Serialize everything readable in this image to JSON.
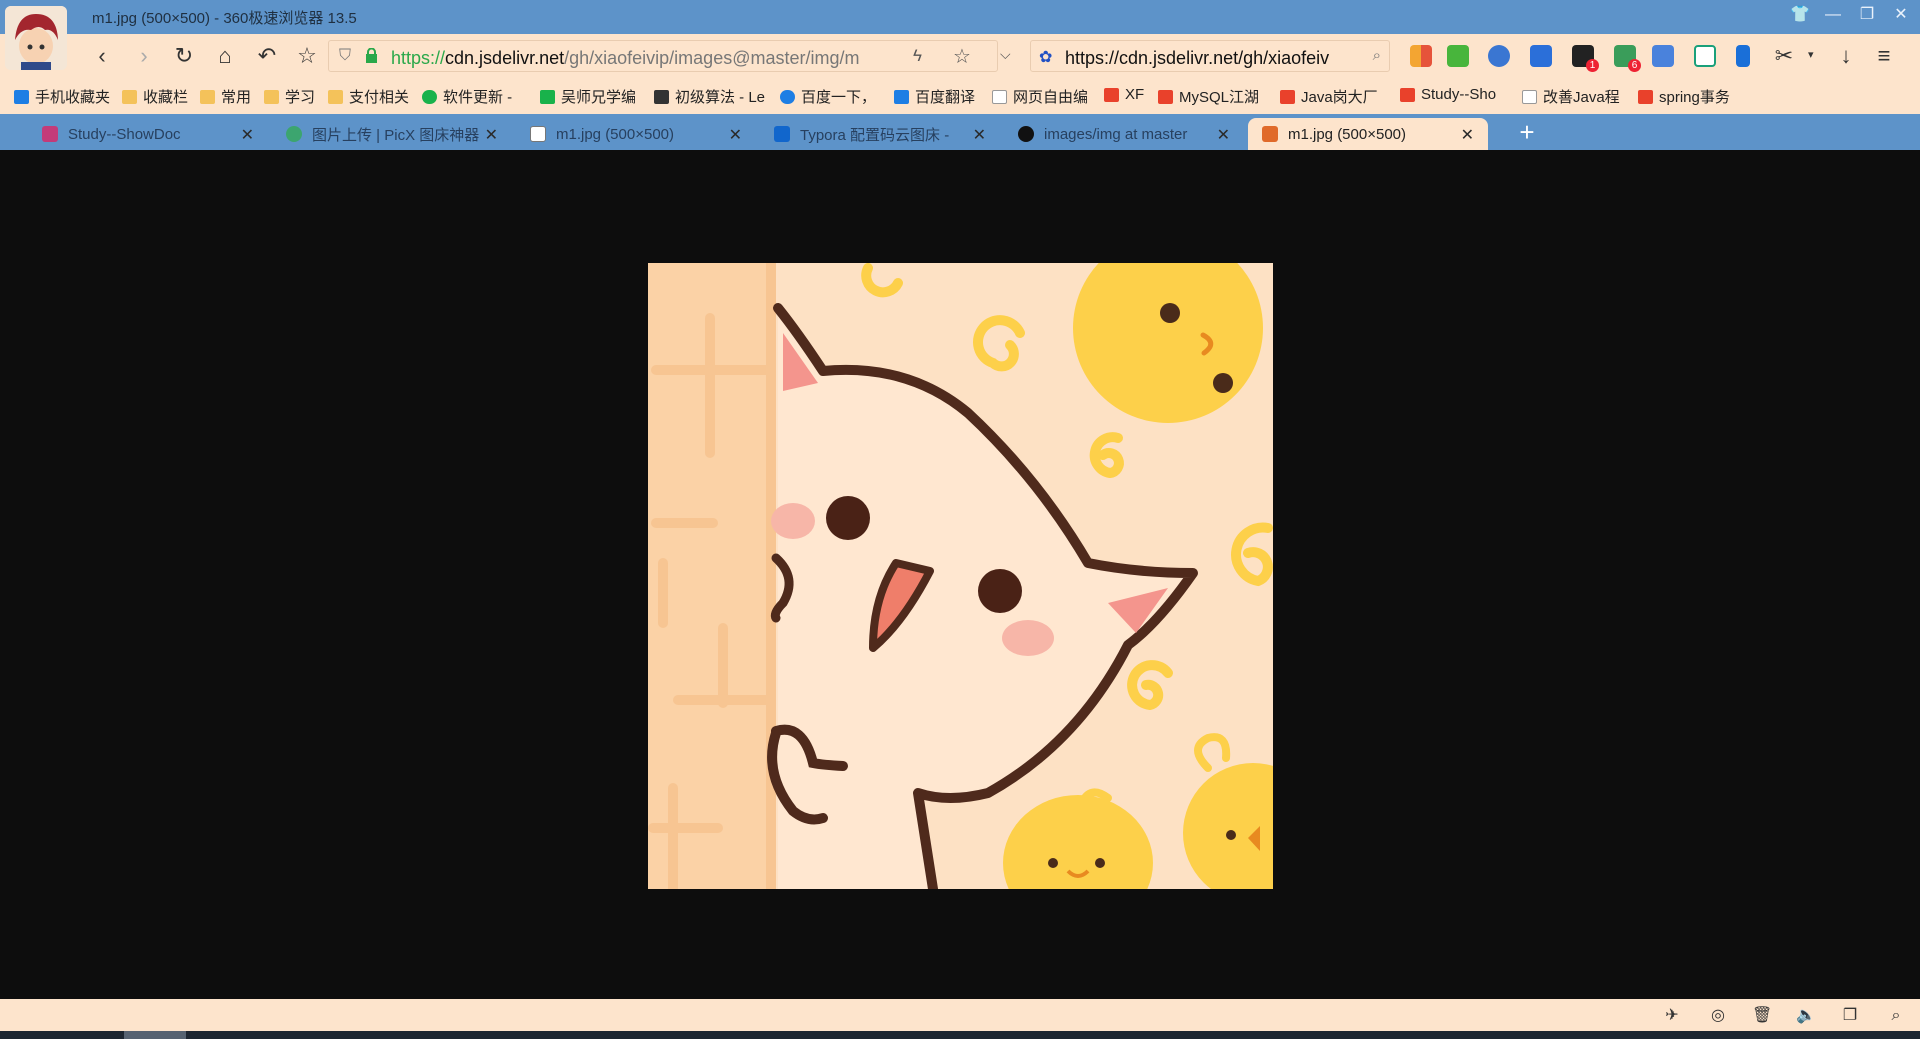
{
  "window": {
    "title": "m1.jpg (500×500) - 360极速浏览器 13.5"
  },
  "nav": {
    "url_protocol": "https://",
    "url_host": "cdn.jsdelivr.net",
    "url_path": "/gh/xiaofeivip/images@master/img/m",
    "search_text": "https://cdn.jsdelivr.net/gh/xiaofeiv"
  },
  "bookmarks": [
    {
      "label": "手机收藏夹",
      "icon": "phone-icon"
    },
    {
      "label": "收藏栏",
      "icon": "folder-icon"
    },
    {
      "label": "常用",
      "icon": "folder-icon"
    },
    {
      "label": "学习",
      "icon": "folder-icon"
    },
    {
      "label": "支付相关",
      "icon": "folder-icon"
    },
    {
      "label": "软件更新 - ",
      "icon": "green-c-icon"
    },
    {
      "label": "吴师兄学编",
      "icon": "green-shield-icon"
    },
    {
      "label": "初级算法 - Le",
      "icon": "leetcode-icon"
    },
    {
      "label": "百度一下，",
      "icon": "baidu-icon"
    },
    {
      "label": "百度翻译",
      "icon": "translate-icon"
    },
    {
      "label": "网页自由编",
      "icon": "page-icon"
    },
    {
      "label": "XF",
      "icon": "feather-icon"
    },
    {
      "label": "MySQL江湖",
      "icon": "csdn-icon"
    },
    {
      "label": "Java岗大厂",
      "icon": "csdn-icon"
    },
    {
      "label": "Study--Sho",
      "icon": "feather-icon"
    },
    {
      "label": "改善Java程",
      "icon": "page-icon"
    },
    {
      "label": "spring事务",
      "icon": "csdn-icon"
    }
  ],
  "tabs": [
    {
      "label": "Study--ShowDoc",
      "icon": "showdoc-icon",
      "active": false
    },
    {
      "label": "图片上传 | PicX 图床神器",
      "icon": "picx-icon",
      "active": false
    },
    {
      "label": "m1.jpg (500×500)",
      "icon": "page-icon",
      "active": false
    },
    {
      "label": "Typora 配置码云图床 - ",
      "icon": "zhihu-icon",
      "active": false
    },
    {
      "label": "images/img at master",
      "icon": "github-icon",
      "active": false
    },
    {
      "label": "m1.jpg (500×500)",
      "icon": "shield-icon",
      "active": true
    }
  ],
  "colors": {
    "titlebar": "#5d93c9",
    "toolbar": "#fde4cc",
    "viewer_bg": "#0d0d0d",
    "url_protocol": "#2aa84a",
    "image_bg": "#fde1c4"
  },
  "badges": {
    "notify_count": "1",
    "apps_count": "6"
  }
}
